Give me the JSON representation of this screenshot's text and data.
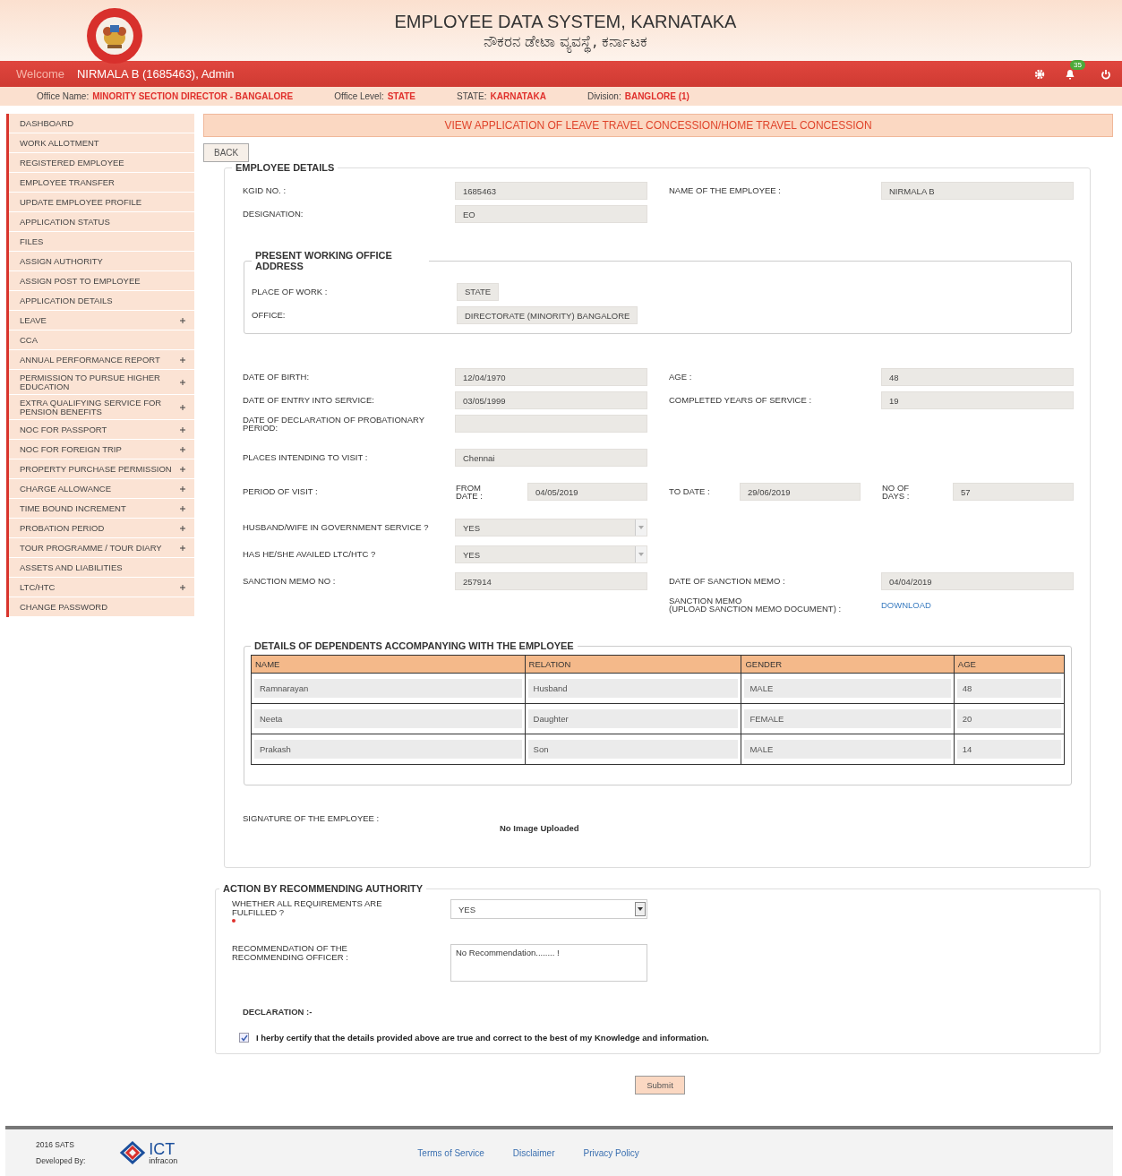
{
  "header": {
    "title": "EMPLOYEE DATA SYSTEM, KARNATAKA",
    "subtitle": "ನೌಕರನ ಡೇಟಾ ವ್ಯವಸ್ಥೆ, ಕರ್ನಾಟಕ"
  },
  "topbar": {
    "greeting": "Welcome",
    "user": "NIRMALA B (1685463), Admin",
    "notification_count": "35"
  },
  "office_bar": [
    {
      "label": "Office Name:",
      "value": "MINORITY SECTION DIRECTOR - BANGALORE"
    },
    {
      "label": "Office Level:",
      "value": "STATE"
    },
    {
      "label": "STATE:",
      "value": "KARNATAKA"
    },
    {
      "label": "Division:",
      "value": "BANGLORE (1)"
    }
  ],
  "sidebar": [
    {
      "label": "DASHBOARD",
      "expandable": false
    },
    {
      "label": "WORK ALLOTMENT",
      "expandable": false
    },
    {
      "label": "REGISTERED EMPLOYEE",
      "expandable": false
    },
    {
      "label": "EMPLOYEE TRANSFER",
      "expandable": false
    },
    {
      "label": "UPDATE EMPLOYEE PROFILE",
      "expandable": false
    },
    {
      "label": "APPLICATION STATUS",
      "expandable": false
    },
    {
      "label": "FILES",
      "expandable": false
    },
    {
      "label": "ASSIGN AUTHORITY",
      "expandable": false
    },
    {
      "label": "ASSIGN POST TO EMPLOYEE",
      "expandable": false
    },
    {
      "label": "APPLICATION DETAILS",
      "expandable": false
    },
    {
      "label": "LEAVE",
      "expandable": true
    },
    {
      "label": "CCA",
      "expandable": false
    },
    {
      "label": "ANNUAL PERFORMANCE REPORT",
      "expandable": true
    },
    {
      "label": "PERMISSION TO PURSUE HIGHER EDUCATION",
      "expandable": true
    },
    {
      "label": "EXTRA QUALIFYING SERVICE FOR PENSION BENEFITS",
      "expandable": true
    },
    {
      "label": "NOC FOR PASSPORT",
      "expandable": true
    },
    {
      "label": "NOC FOR FOREIGN TRIP",
      "expandable": true
    },
    {
      "label": "PROPERTY PURCHASE PERMISSION",
      "expandable": true
    },
    {
      "label": "CHARGE ALLOWANCE",
      "expandable": true
    },
    {
      "label": "TIME BOUND INCREMENT",
      "expandable": true
    },
    {
      "label": "PROBATION PERIOD",
      "expandable": true
    },
    {
      "label": "TOUR PROGRAMME / TOUR DIARY",
      "expandable": true
    },
    {
      "label": "ASSETS AND LIABILITIES",
      "expandable": false
    },
    {
      "label": "LTC/HTC",
      "expandable": true
    },
    {
      "label": "CHANGE PASSWORD",
      "expandable": false
    }
  ],
  "page_title": "VIEW APPLICATION OF LEAVE TRAVEL CONCESSION/HOME TRAVEL CONCESSION",
  "back_button": "BACK",
  "employee_details": {
    "legend": "EMPLOYEE DETAILS",
    "rows": [
      {
        "kind": "pair",
        "left": {
          "label": "KGID NO. :",
          "kind": "text",
          "value": "1685463"
        },
        "right": {
          "label": "NAME OF THE EMPLOYEE :",
          "kind": "text",
          "value": "NIRMALA B"
        }
      },
      {
        "kind": "pair",
        "left": {
          "label": "DESIGNATION:",
          "kind": "text",
          "value": "EO"
        }
      },
      {
        "kind": "group",
        "legend": "PRESENT WORKING OFFICE ADDRESS",
        "rows": [
          {
            "label": "PLACE OF WORK :",
            "value": "STATE"
          },
          {
            "label": "OFFICE:",
            "value": "DIRECTORATE (MINORITY) BANGALORE"
          }
        ]
      },
      {
        "kind": "pair",
        "left": {
          "label": "DATE OF BIRTH:",
          "kind": "text",
          "value": "12/04/1970"
        },
        "right": {
          "label": "AGE :",
          "kind": "text",
          "value": "48"
        }
      },
      {
        "kind": "pair",
        "left": {
          "label": "DATE OF ENTRY INTO SERVICE:",
          "kind": "text",
          "value": "03/05/1999"
        },
        "right": {
          "label": "COMPLETED YEARS OF SERVICE :",
          "kind": "text",
          "value": "19"
        }
      },
      {
        "kind": "pair",
        "left": {
          "label": "DATE OF DECLARATION OF PROBATIONARY PERIOD:",
          "kind": "text"
        }
      },
      {
        "kind": "pair",
        "left": {
          "label": "PLACES INTENDING TO VISIT :",
          "kind": "text",
          "value": "Chennai"
        }
      },
      {
        "kind": "period",
        "label": "PERIOD OF VISIT :",
        "from_label": "FROM DATE :",
        "from": "04/05/2019",
        "to_label": "TO DATE :",
        "to": "29/06/2019",
        "days_label": "NO OF DAYS :",
        "days": "57"
      },
      {
        "kind": "pair",
        "left": {
          "label": "HUSBAND/WIFE IN GOVERNMENT SERVICE ?",
          "kind": "select",
          "value": "YES"
        }
      },
      {
        "kind": "pair",
        "left": {
          "label": "HAS HE/SHE AVAILED LTC/HTC ?",
          "kind": "select",
          "value": "YES"
        }
      },
      {
        "kind": "pair",
        "left": {
          "label": "SANCTION MEMO NO :",
          "kind": "text",
          "value": "257914"
        },
        "right": {
          "label": "DATE OF SANCTION MEMO :",
          "kind": "text",
          "value": "04/04/2019"
        }
      },
      {
        "kind": "pair",
        "right": {
          "label": "SANCTION MEMO\n(UPLOAD SANCTION MEMO DOCUMENT) :",
          "kind": "link",
          "value": "DOWNLOAD"
        }
      },
      {
        "kind": "table",
        "legend": "DETAILS OF DEPENDENTS ACCOMPANYING WITH THE EMPLOYEE",
        "columns": [
          "NAME",
          "RELATION",
          "GENDER",
          "AGE"
        ],
        "rows": [
          [
            "Ramnarayan",
            "Husband",
            "MALE",
            "48"
          ],
          [
            "Neeta",
            "Daughter",
            "FEMALE",
            "20"
          ],
          [
            "Prakash",
            "Son",
            "MALE",
            "14"
          ]
        ]
      },
      {
        "kind": "signature",
        "label": "SIGNATURE OF THE EMPLOYEE :",
        "value": "No Image Uploaded"
      }
    ]
  },
  "action": {
    "legend": "ACTION BY RECOMMENDING AUTHORITY",
    "requirement": {
      "label": "WHETHER ALL REQUIREMENTS ARE FULFILLED ?",
      "required": true,
      "value": "YES"
    },
    "recommendation": {
      "label": "RECOMMENDATION OF THE RECOMMENDING OFFICER :",
      "value": "No Recommendation........ !"
    },
    "declaration_title": "DECLARATION :-",
    "declaration": {
      "checked": true,
      "text": "I herby certify that the details provided above are true and correct to the best of my Knowledge and information."
    }
  },
  "submit_button": "Submit",
  "footer": {
    "copyright": "2016 SATS",
    "developed_by": "Developed By:",
    "logo_title": "ICT",
    "logo_subtitle": "infracon",
    "links": [
      "Terms of Service",
      "Disclaimer",
      "Privacy Policy"
    ]
  }
}
